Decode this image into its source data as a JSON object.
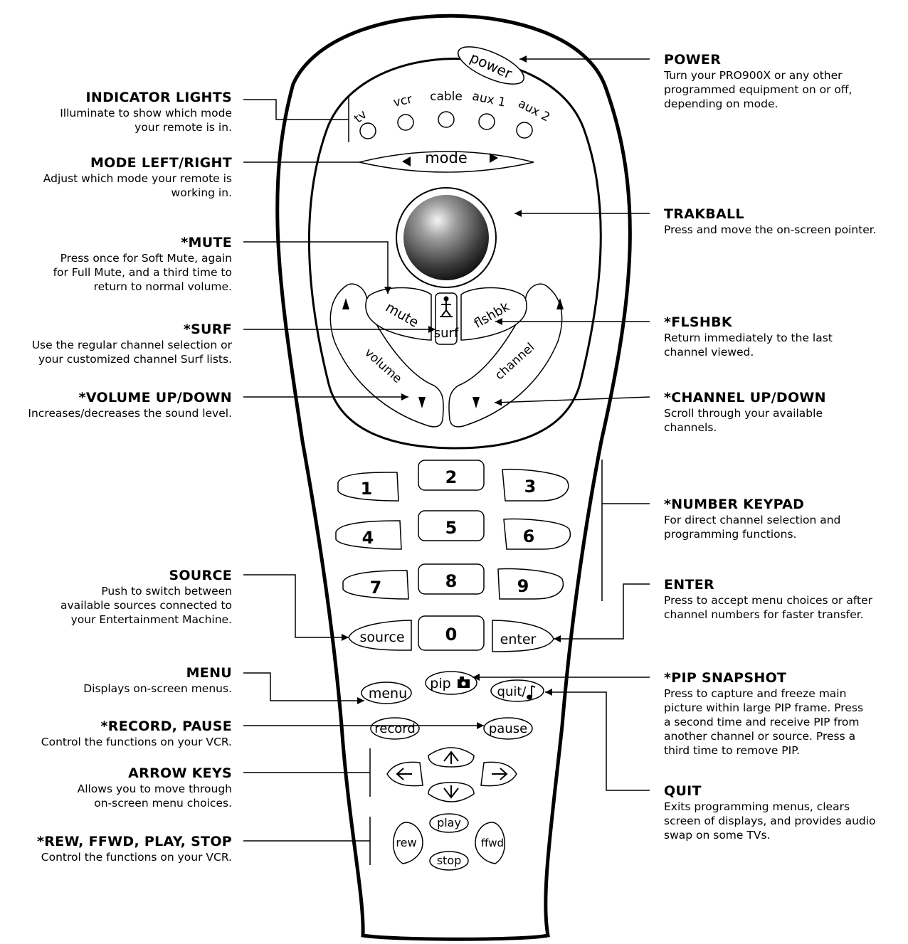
{
  "colors": {
    "ink": "#000000",
    "background": "#ffffff"
  },
  "annotations_left": [
    {
      "id": "indicator",
      "title": "INDICATOR LIGHTS",
      "desc": [
        "Illuminate to show which mode",
        "your remote is in."
      ]
    },
    {
      "id": "mode",
      "title": "MODE LEFT/RIGHT",
      "desc": [
        "Adjust which mode your remote is",
        "working in."
      ]
    },
    {
      "id": "mute",
      "title": "*MUTE",
      "desc": [
        "Press once for Soft Mute, again",
        "for Full Mute, and a third time to",
        "return to normal volume."
      ]
    },
    {
      "id": "surf",
      "title": "*SURF",
      "desc": [
        "Use the regular channel selection or",
        "your customized channel Surf lists."
      ]
    },
    {
      "id": "volume",
      "title": "*VOLUME UP/DOWN",
      "desc": [
        "Increases/decreases the sound level."
      ]
    },
    {
      "id": "source",
      "title": "SOURCE",
      "desc": [
        "Push to switch between",
        "available sources connected to",
        "your Entertainment Machine."
      ]
    },
    {
      "id": "menu",
      "title": "MENU",
      "desc": [
        "Displays on-screen menus."
      ]
    },
    {
      "id": "record",
      "title": "*RECORD, PAUSE",
      "desc": [
        "Control the functions on your VCR."
      ]
    },
    {
      "id": "arrows",
      "title": "ARROW KEYS",
      "desc": [
        "Allows you to move through",
        "on-screen menu choices."
      ]
    },
    {
      "id": "vcr",
      "title": "*REW, FFWD, PLAY, STOP",
      "desc": [
        "Control the functions on your VCR."
      ]
    }
  ],
  "annotations_right": [
    {
      "id": "power",
      "title": "POWER",
      "desc": [
        "Turn your PRO900X or any other",
        "programmed equipment on or off,",
        "depending on mode."
      ]
    },
    {
      "id": "trakball",
      "title": "TRAKBALL",
      "desc": [
        "Press and move the on-screen pointer."
      ]
    },
    {
      "id": "flshbk",
      "title": "*FLSHBK",
      "desc": [
        "Return immediately to the last",
        "channel viewed."
      ]
    },
    {
      "id": "channel",
      "title": "*CHANNEL UP/DOWN",
      "desc": [
        "Scroll through your available",
        "channels."
      ]
    },
    {
      "id": "keypad",
      "title": "*NUMBER KEYPAD",
      "desc": [
        "For direct channel selection and",
        "programming functions."
      ]
    },
    {
      "id": "enter",
      "title": "ENTER",
      "desc": [
        "Press to accept menu choices or after",
        "channel numbers for faster transfer."
      ]
    },
    {
      "id": "pip",
      "title": "*PIP SNAPSHOT",
      "desc": [
        "Press to capture and freeze main",
        "picture within large PIP frame. Press",
        "a second time and receive PIP from",
        "another channel or source. Press a",
        "third time to remove PIP."
      ]
    },
    {
      "id": "quit",
      "title": "QUIT",
      "desc": [
        "Exits programming menus, clears",
        "screen of displays, and provides audio",
        "swap on some TVs."
      ]
    }
  ],
  "remote": {
    "power": "power",
    "lights": [
      "tv",
      "vcr",
      "cable",
      "aux 1",
      "aux 2"
    ],
    "mode": "mode",
    "mute": "mute",
    "surf": "surf",
    "flshbk": "flshbk",
    "volume": "volume",
    "channel": "channel",
    "keys": [
      "1",
      "2",
      "3",
      "4",
      "5",
      "6",
      "7",
      "8",
      "9",
      "0"
    ],
    "source": "source",
    "enter": "enter",
    "menu": "menu",
    "pip": "pip",
    "quit": "quit/",
    "record": "record",
    "pause": "pause",
    "play": "play",
    "rew": "rew",
    "ffwd": "ffwd",
    "stop": "stop"
  }
}
